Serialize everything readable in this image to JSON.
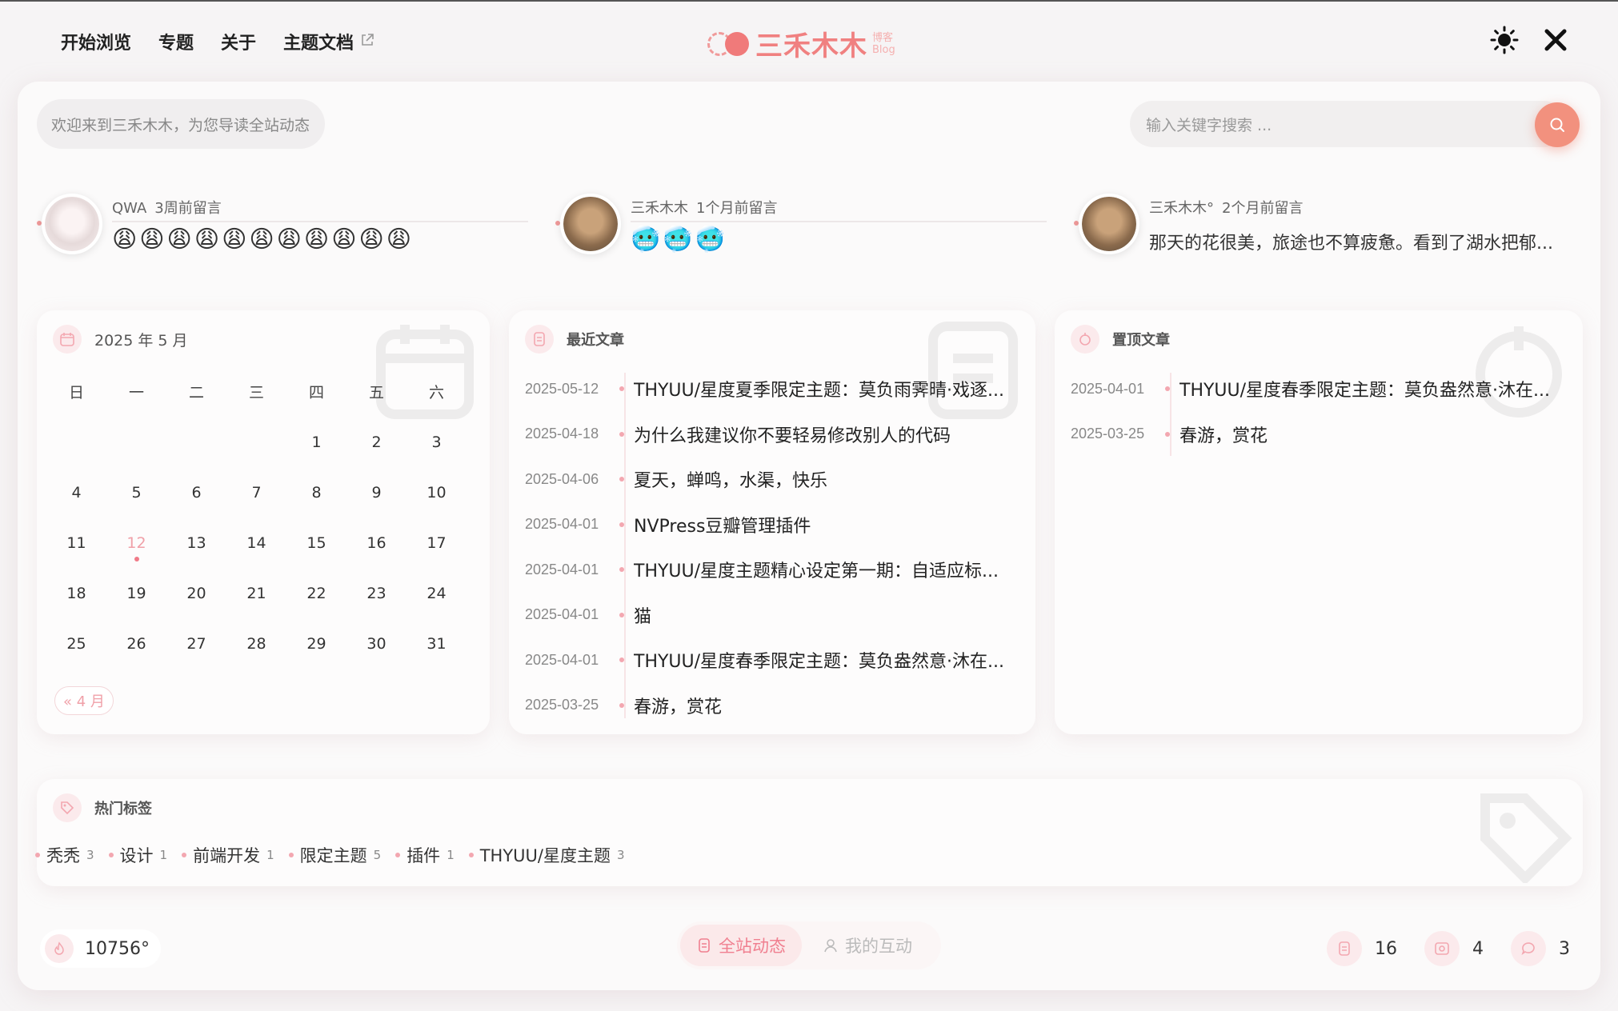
{
  "header": {
    "nav": [
      "开始浏览",
      "专题",
      "关于",
      "主题文档"
    ],
    "logo_name": "三禾木木",
    "logo_sub_top": "博客",
    "logo_sub_bottom": "Blog"
  },
  "welcome_text": "欢迎来到三禾木木，为您导读全站动态",
  "search": {
    "placeholder": "输入关键字搜索 ..."
  },
  "comments": [
    {
      "user": "QWA",
      "time": "3周前留言",
      "content": "😩😩😩😩😩😩😩😩😩😩😩"
    },
    {
      "user": "三禾木木",
      "time": "1个月前留言",
      "content": "🥶🥶🥶"
    },
    {
      "user": "三禾木木°",
      "time": "2个月前留言",
      "content": "那天的花很美，旅途也不算疲惫。看到了湖水把郁..."
    }
  ],
  "calendar": {
    "title": "2025 年 5 月",
    "weekdays": [
      "日",
      "一",
      "二",
      "三",
      "四",
      "五",
      "六"
    ],
    "weeks": [
      [
        "",
        "",
        "",
        "",
        "1",
        "2",
        "3"
      ],
      [
        "4",
        "5",
        "6",
        "7",
        "8",
        "9",
        "10"
      ],
      [
        "11",
        "12",
        "13",
        "14",
        "15",
        "16",
        "17"
      ],
      [
        "18",
        "19",
        "20",
        "21",
        "22",
        "23",
        "24"
      ],
      [
        "25",
        "26",
        "27",
        "28",
        "29",
        "30",
        "31"
      ]
    ],
    "today": "12",
    "prev_label": "« 4 月"
  },
  "recent": {
    "title": "最近文章",
    "items": [
      {
        "date": "2025-05-12",
        "title": "THYUU/星度夏季限定主题：莫负雨霁晴·戏逐..."
      },
      {
        "date": "2025-04-18",
        "title": "为什么我建议你不要轻易修改别人的代码"
      },
      {
        "date": "2025-04-06",
        "title": "夏天，蝉鸣，水渠，快乐"
      },
      {
        "date": "2025-04-01",
        "title": "NVPress豆瓣管理插件"
      },
      {
        "date": "2025-04-01",
        "title": "THYUU/星度主题精心设定第一期：自适应标..."
      },
      {
        "date": "2025-04-01",
        "title": "猫"
      },
      {
        "date": "2025-04-01",
        "title": "THYUU/星度春季限定主题：莫负盎然意·沐在..."
      },
      {
        "date": "2025-03-25",
        "title": "春游，赏花"
      }
    ]
  },
  "pinned": {
    "title": "置顶文章",
    "items": [
      {
        "date": "2025-04-01",
        "title": "THYUU/星度春季限定主题：莫负盎然意·沐在..."
      },
      {
        "date": "2025-03-25",
        "title": "春游，赏花"
      }
    ]
  },
  "tags": {
    "title": "热门标签",
    "items": [
      {
        "name": "秃秃",
        "count": "3"
      },
      {
        "name": "设计",
        "count": "1"
      },
      {
        "name": "前端开发",
        "count": "1"
      },
      {
        "name": "限定主题",
        "count": "5"
      },
      {
        "name": "插件",
        "count": "1"
      },
      {
        "name": "THYUU/星度主题",
        "count": "3"
      }
    ]
  },
  "footer": {
    "heat": "10756°",
    "tabs": [
      "全站动态",
      "我的互动"
    ],
    "stats": {
      "posts": "16",
      "albums": "4",
      "comments": "3"
    }
  },
  "colors": {
    "accent": "#f08080",
    "search_button": "#f2917e"
  }
}
